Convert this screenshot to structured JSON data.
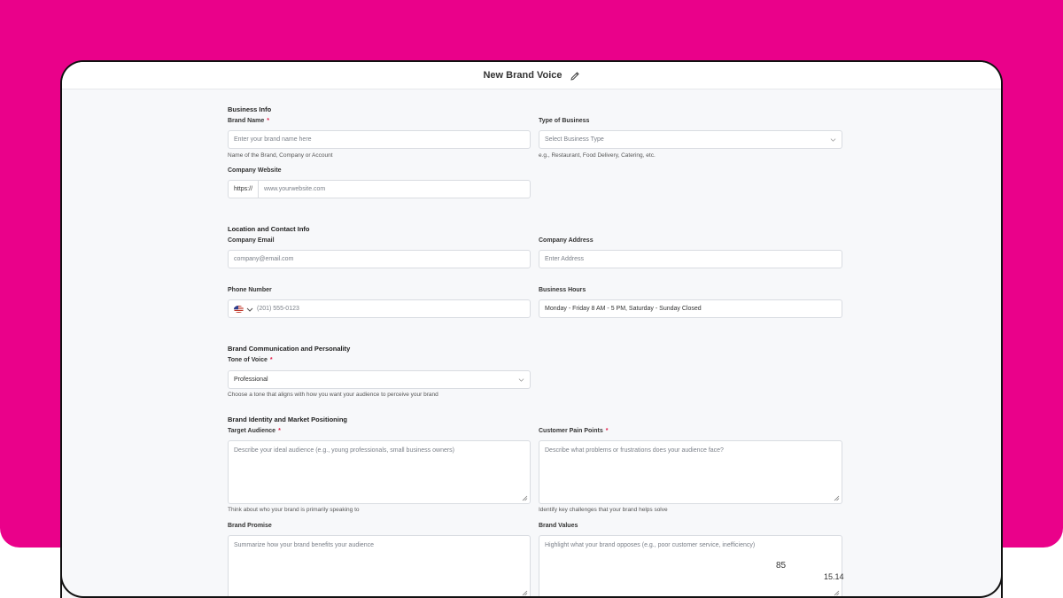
{
  "window": {
    "title": "New Brand Voice"
  },
  "sections": {
    "business": "Business Info",
    "location": "Location and Contact Info",
    "communication": "Brand Communication and Personality",
    "identity": "Brand Identity and Market Positioning"
  },
  "fields": {
    "brand_name": {
      "label": "Brand Name",
      "required": "*",
      "placeholder": "Enter your brand name here",
      "help": "Name of the Brand, Company or Account"
    },
    "business_type": {
      "label": "Type of Business",
      "placeholder": "Select Business Type",
      "help": "e.g., Restaurant, Food Delivery, Catering, etc."
    },
    "website": {
      "label": "Company Website",
      "prefix": "https://",
      "placeholder": "www.yourwebsite.com"
    },
    "email": {
      "label": "Company Email",
      "placeholder": "company@email.com"
    },
    "address": {
      "label": "Company Address",
      "placeholder": "Enter Address"
    },
    "phone": {
      "label": "Phone Number",
      "placeholder": "(201) 555-0123"
    },
    "hours": {
      "label": "Business Hours",
      "value": "Monday - Friday 8 AM - 5 PM, Saturday - Sunday Closed"
    },
    "tone": {
      "label": "Tone of Voice",
      "required": "*",
      "value": "Professional",
      "help": "Choose a tone that aligns with how you want your audience to perceive your brand"
    },
    "audience": {
      "label": "Target Audience",
      "required": "*",
      "placeholder": "Describe your ideal audience (e.g., young professionals, small business owners)",
      "help": "Think about who your brand is primarily speaking to"
    },
    "pain_points": {
      "label": "Customer Pain Points",
      "required": "*",
      "placeholder": "Describe what problems or frustrations does your audience face?",
      "help": "Identify key challenges that your brand helps solve"
    },
    "promise": {
      "label": "Brand Promise",
      "placeholder": "Summarize how your brand benefits your audience"
    },
    "values": {
      "label": "Brand Values",
      "placeholder": "Highlight what your brand opposes (e.g., poor customer service, inefficiency)"
    }
  },
  "overlay": {
    "num1": "85",
    "num2": "15.14"
  },
  "icons": {
    "edit": "pencil-icon",
    "dropdown": "chevron-down-icon",
    "flag": "us-flag-icon",
    "resize": "resize-grip-icon"
  },
  "colors": {
    "accent_bg": "#ea018a",
    "required": "#e11d48"
  }
}
